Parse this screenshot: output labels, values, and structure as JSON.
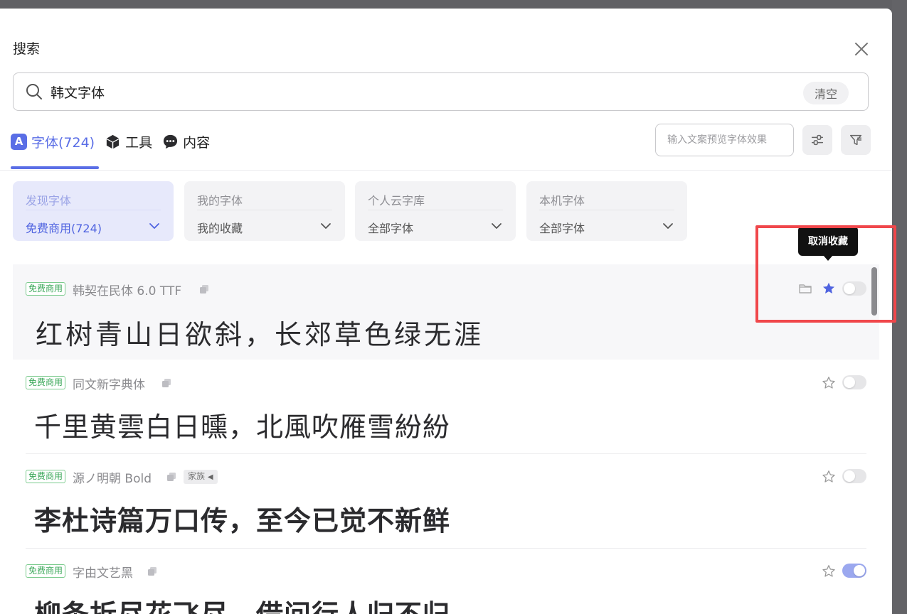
{
  "modal": {
    "title": "搜索"
  },
  "search": {
    "value": "韩文字体",
    "clear_label": "清空"
  },
  "tabs": [
    {
      "label": "字体(724)",
      "icon": "font-a-icon"
    },
    {
      "label": "工具",
      "icon": "cube-icon"
    },
    {
      "label": "内容",
      "icon": "chat-bubble-icon"
    }
  ],
  "preview_input": {
    "placeholder": "输入文案预览字体效果"
  },
  "filters": [
    {
      "title": "发现字体",
      "value": "免费商用(724)"
    },
    {
      "title": "我的字体",
      "value": "我的收藏"
    },
    {
      "title": "个人云字库",
      "value": "全部字体"
    },
    {
      "title": "本机字体",
      "value": "全部字体"
    }
  ],
  "tooltip": {
    "text": "取消收藏"
  },
  "fonts": [
    {
      "badge": "免费商用",
      "name": "韩契在民体 6.0 TTF",
      "preview": "红树青山日欲斜，长郊草色绿无涯",
      "favorited": true,
      "enabled": false
    },
    {
      "badge": "免费商用",
      "name": "同文新字典体",
      "preview": "千里黄雲白日曛，北風吹雁雪紛紛",
      "favorited": false,
      "enabled": false
    },
    {
      "badge": "免费商用",
      "name": "源ノ明朝 Bold",
      "family_tag": "家族",
      "preview": "李杜诗篇万口传，至今已觉不新鲜",
      "favorited": false,
      "enabled": false
    },
    {
      "badge": "免费商用",
      "name": "字由文艺黑",
      "preview": "柳条折尽花飞尽，借问行人归不归",
      "favorited": false,
      "enabled": true
    }
  ],
  "colors": {
    "accent": "#5a6ee6",
    "badge_green": "#3ca85a",
    "highlight_red": "#f0474b"
  }
}
